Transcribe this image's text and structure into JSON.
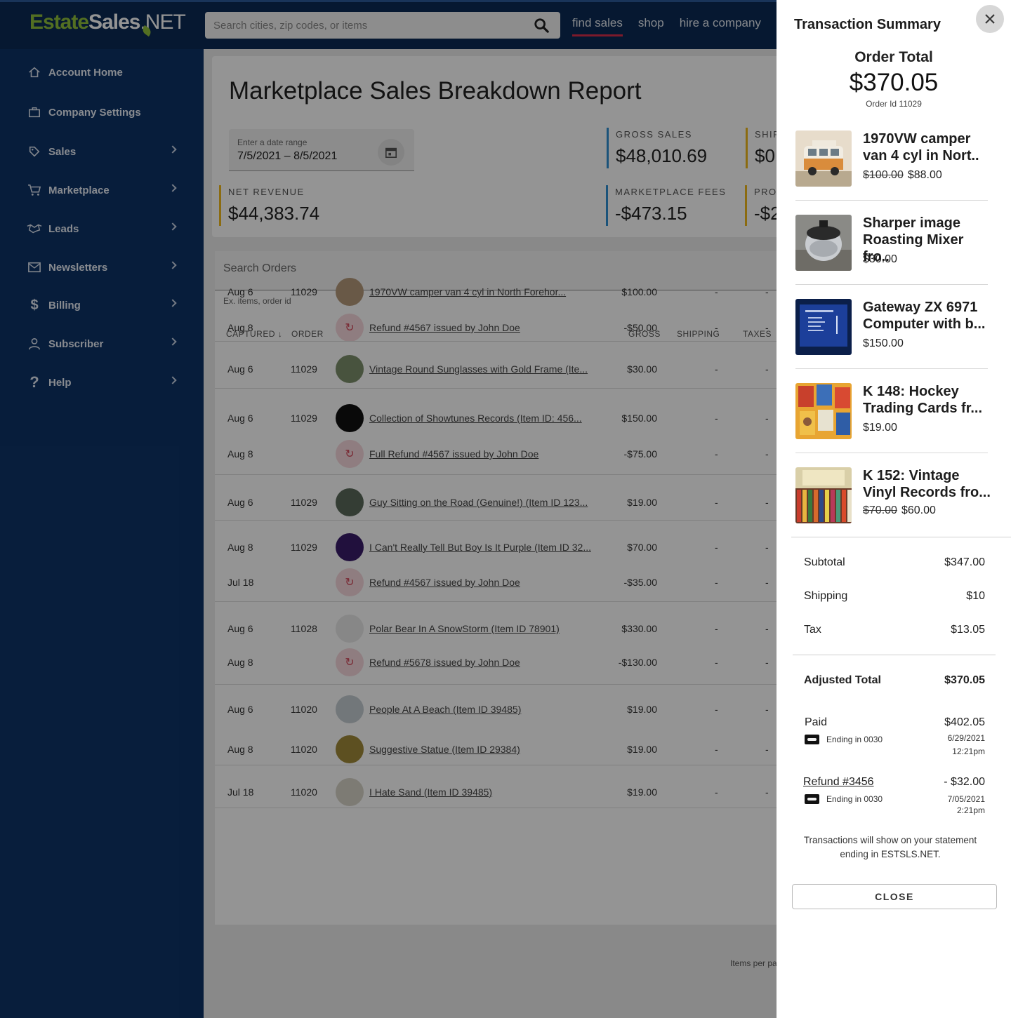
{
  "header": {
    "logo_part1": "Estate",
    "logo_part2": "Sales",
    "logo_part3": ".NET",
    "search_placeholder": "Search cities, zip codes, or items",
    "nav": [
      "find sales",
      "shop",
      "hire a company"
    ],
    "active_nav": "find sales",
    "accent_color": "#d62e4a"
  },
  "sidebar": {
    "items": [
      {
        "label": "Account Home",
        "icon": "home-icon",
        "has_submenu": false
      },
      {
        "label": "Company Settings",
        "icon": "briefcase-icon",
        "has_submenu": false
      },
      {
        "label": "Sales",
        "icon": "tag-icon",
        "has_submenu": true
      },
      {
        "label": "Marketplace",
        "icon": "cart-icon",
        "has_submenu": true
      },
      {
        "label": "Leads",
        "icon": "handshake-icon",
        "has_submenu": true
      },
      {
        "label": "Newsletters",
        "icon": "mail-icon",
        "has_submenu": true
      },
      {
        "label": "Billing",
        "icon": "dollar-icon",
        "has_submenu": true
      },
      {
        "label": "Subscriber",
        "icon": "person-icon",
        "has_submenu": true
      },
      {
        "label": "Help",
        "icon": "question-icon",
        "has_submenu": true
      }
    ]
  },
  "report": {
    "title": "Marketplace Sales Breakdown Report",
    "date_label": "Enter a date range",
    "date_value": "7/5/2021 – 8/5/2021",
    "stats": {
      "gross_label": "GROSS SALES",
      "gross_value": "$48,010.69",
      "ship_label": "SHIP",
      "ship_value": "$0.",
      "net_label": "NET REVENUE",
      "net_value": "$44,383.74",
      "fees_label": "MARKETPLACE FEES",
      "fees_value": "-$473.15",
      "proc_label": "PROC",
      "proc_value": "-$2"
    }
  },
  "orders": {
    "search_placeholder": "Search Orders",
    "search_hint": "Ex. items, order id",
    "columns": {
      "captured": "CAPTURED",
      "order": "ORDER",
      "gross": "GROSS",
      "shipping": "SHIPPING",
      "taxes": "TAXES"
    },
    "rows": [
      {
        "date": "Aug 6",
        "order": "11029",
        "item": "1970VW camper van 4 cyl in North Forehor...",
        "gross": "$100.00",
        "ship": "-",
        "tax": "-",
        "kind": "item",
        "thumb": "#b69a7a"
      },
      {
        "date": "Aug 8",
        "order": "",
        "item": "Refund #4567 issued by John Doe",
        "gross": "-$50.00",
        "ship": "-",
        "tax": "-",
        "kind": "refund"
      },
      {
        "date": "Aug 6",
        "order": "11029",
        "item": "Vintage Round Sunglasses with Gold Frame (Ite...",
        "gross": "$30.00",
        "ship": "-",
        "tax": "-",
        "kind": "item",
        "thumb": "#7d8f6c"
      },
      {
        "date": "Aug 6",
        "order": "11029",
        "item": "Collection of Showtunes Records (Item ID: 456...",
        "gross": "$150.00",
        "ship": "-",
        "tax": "-",
        "kind": "item",
        "thumb": "#111111"
      },
      {
        "date": "Aug 8",
        "order": "",
        "item": "Full Refund #4567 issued by John Doe",
        "gross": "-$75.00",
        "ship": "-",
        "tax": "-",
        "kind": "refund"
      },
      {
        "date": "Aug 6",
        "order": "11029",
        "item": "Guy Sitting on the Road (Genuine!) (Item ID 123...",
        "gross": "$19.00",
        "ship": "-",
        "tax": "-",
        "kind": "item",
        "thumb": "#5a6a5a"
      },
      {
        "date": "Aug 8",
        "order": "11029",
        "item": "I Can't Really Tell But Boy Is It Purple (Item ID 32...",
        "gross": "$70.00",
        "ship": "-",
        "tax": "-",
        "kind": "item",
        "thumb": "#3a1d6a"
      },
      {
        "date": "Jul 18",
        "order": "",
        "item": "Refund #4567 issued by John Doe",
        "gross": "-$35.00",
        "ship": "-",
        "tax": "-",
        "kind": "refund"
      },
      {
        "date": "Aug 6",
        "order": "11028",
        "item": "Polar Bear In A SnowStorm (Item ID 78901)",
        "gross": "$330.00",
        "ship": "-",
        "tax": "-",
        "kind": "item",
        "thumb": "#e8e8e8"
      },
      {
        "date": "Aug 8",
        "order": "",
        "item": "Refund #5678 issued by John Doe",
        "gross": "-$130.00",
        "ship": "-",
        "tax": "-",
        "kind": "refund"
      },
      {
        "date": "Aug 6",
        "order": "11020",
        "item": "People At A Beach (Item ID 39485)",
        "gross": "$19.00",
        "ship": "-",
        "tax": "-",
        "kind": "item",
        "thumb": "#c4cdd2"
      },
      {
        "date": "Aug 8",
        "order": "11020",
        "item": "Suggestive Statue (Item ID 29384)",
        "gross": "$19.00",
        "ship": "-",
        "tax": "-",
        "kind": "item",
        "thumb": "#a08a3a"
      },
      {
        "date": "Jul 18",
        "order": "11020",
        "item": "I Hate Sand (Item ID 39485)",
        "gross": "$19.00",
        "ship": "-",
        "tax": "-",
        "kind": "item",
        "thumb": "#d8d4c8"
      }
    ],
    "items_per_page": "Items per pa"
  },
  "drawer": {
    "title": "Transaction Summary",
    "order_total_label": "Order Total",
    "order_total": "$370.05",
    "order_id": "Order Id 11029",
    "items": [
      {
        "name_line1": "1970VW camper",
        "name_line2": "van 4 cyl in Nort..",
        "old_price": "$100.00",
        "price": "$88.00"
      },
      {
        "name_line1": "Sharper image",
        "name_line2": "Roasting Mixer fro..",
        "old_price": "",
        "price": "$30.00"
      },
      {
        "name_line1": "Gateway ZX 6971",
        "name_line2": "Computer with b...",
        "old_price": "",
        "price": "$150.00"
      },
      {
        "name_line1": "K 148: Hockey",
        "name_line2": "Trading Cards fr...",
        "old_price": "",
        "price": "$19.00"
      },
      {
        "name_line1": "K 152: Vintage",
        "name_line2": "Vinyl Records fro...",
        "old_price": "$70.00",
        "price": "$60.00"
      }
    ],
    "subtotal_label": "Subtotal",
    "subtotal": "$347.00",
    "shipping_label": "Shipping",
    "shipping": "$10",
    "tax_label": "Tax",
    "tax": "$13.05",
    "adjusted_label": "Adjusted Total",
    "adjusted_total": "$370.05",
    "paid_label": "Paid",
    "paid_amount": "$402.05",
    "paid_card": "Ending in 0030",
    "paid_date": "6/29/2021",
    "paid_time": "12:21pm",
    "refund_label": "Refund #3456",
    "refund_amount": "- $32.00",
    "refund_card": "Ending in 0030",
    "refund_date": "7/05/2021",
    "refund_time": "2:21pm",
    "note": "Transactions will show on your statement ending in ESTSLS.NET.",
    "close_label": "CLOSE"
  }
}
